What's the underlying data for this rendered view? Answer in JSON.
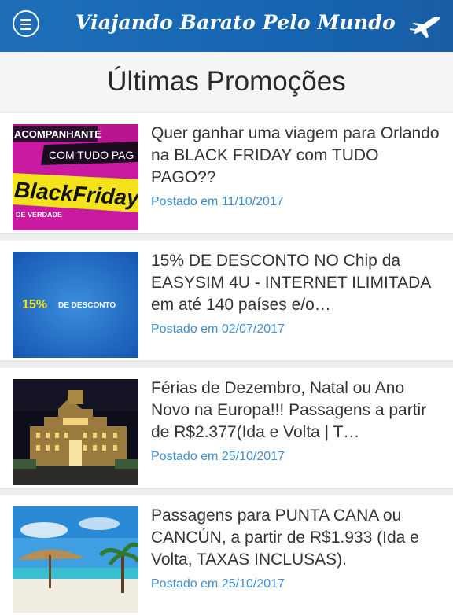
{
  "app": {
    "title": "Viajando Barato Pelo Mundo"
  },
  "section": {
    "title": "Últimas Promoções"
  },
  "posts": [
    {
      "title": "Quer ganhar uma viagem para Orlando na BLACK FRIDAY com TUDO PAGO??",
      "date": "Postado em 11/10/2017",
      "thumb": {
        "line1": "ACOMPANHANTE",
        "line2": "COM TUDO PAG",
        "line3": "BlackFriday",
        "line4": "DE VERDADE"
      }
    },
    {
      "title": "15% DE DESCONTO NO Chip da EASYSIM 4U - INTERNET ILIMITADA em até 140 países e/o…",
      "date": "Postado em 02/07/2017",
      "thumb": {
        "percent": "15%",
        "label": "DE DESCONTO"
      }
    },
    {
      "title": "Férias de Dezembro, Natal ou Ano Novo na Europa!!! Passagens a partir de R$2.377(Ida e Volta | T…",
      "date": "Postado em 25/10/2017"
    },
    {
      "title": "Passagens para PUNTA CANA ou CANCÚN, a partir de R$1.933 (Ida e Volta, TAXAS INCLUSAS).",
      "date": "Postado em 25/10/2017"
    }
  ]
}
